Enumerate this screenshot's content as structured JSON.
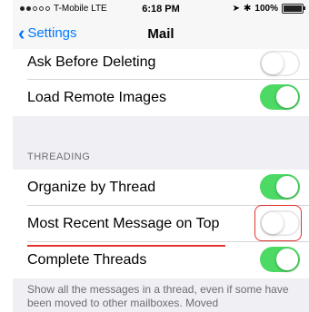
{
  "status_bar": {
    "carrier": "T-Mobile  LTE",
    "time": "6:18 PM",
    "battery": "100%"
  },
  "nav": {
    "back_label": "Settings",
    "title": "Mail"
  },
  "rows_top": [
    {
      "label": "Ask Before Deleting",
      "on": false
    },
    {
      "label": "Load Remote Images",
      "on": true
    }
  ],
  "threading": {
    "header": "THREADING",
    "rows": [
      {
        "label": "Organize by Thread",
        "on": true
      },
      {
        "label": "Most Recent Message on Top",
        "on": false
      },
      {
        "label": "Complete Threads",
        "on": true
      }
    ],
    "footer": "Show all the messages in a thread, even if some have been moved to other mailboxes. Moved"
  },
  "colors": {
    "toggle_on": "#4cd964",
    "accent": "#007aff",
    "annotation": "#e0342f"
  }
}
